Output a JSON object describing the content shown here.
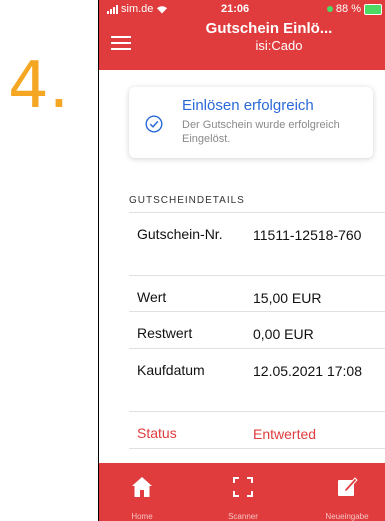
{
  "step_number": "4.",
  "status_bar": {
    "carrier": "sim.de",
    "time": "21:06",
    "battery": "88 %"
  },
  "header": {
    "title": "Gutschein Einlö...",
    "subtitle": "isi:Cado"
  },
  "toast": {
    "title": "Einlösen erfolgreich",
    "text": "Der Gutschein wurde erfolgreich Eingelöst."
  },
  "section_title": "GUTSCHEINDETAILS",
  "details": [
    {
      "label": "Gutschein-Nr.",
      "value": "11511-12518-760"
    },
    {
      "label": "Wert",
      "value": "15,00 EUR"
    },
    {
      "label": "Restwert",
      "value": "0,00 EUR"
    },
    {
      "label": "Kaufdatum",
      "value": "12.05.2021 17:08"
    },
    {
      "label": "Status",
      "value": "Entwerted"
    }
  ],
  "bottom_nav": [
    {
      "label": "Home",
      "icon": "home-icon"
    },
    {
      "label": "Scanner",
      "icon": "scan-icon"
    },
    {
      "label": "Neueingabe",
      "icon": "edit-icon"
    }
  ],
  "colors": {
    "brand": "#e03b3d",
    "accent": "#2a69d8",
    "step": "#f5a623"
  }
}
